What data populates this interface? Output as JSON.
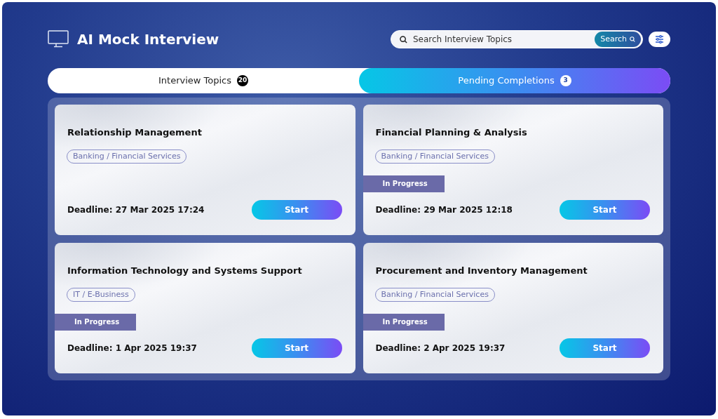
{
  "header": {
    "title": "AI Mock Interview",
    "search": {
      "placeholder": "Search Interview Topics",
      "button": "Search"
    }
  },
  "tabs": [
    {
      "label": "Interview Topics",
      "count": "20",
      "selected": false
    },
    {
      "label": "Pending Completions",
      "count": "3",
      "selected": true
    }
  ],
  "cards": [
    {
      "title": "Relationship Management",
      "tag": "Banking / Financial Services",
      "deadline": "Deadline: 27 Mar 2025 17:24",
      "button": "Start"
    },
    {
      "title": "Financial Planning & Analysis",
      "tag": "Banking / Financial Services",
      "status": "In Progress",
      "deadline": "Deadline: 29 Mar 2025 12:18",
      "button": "Start"
    },
    {
      "title": "Information Technology and Systems Support",
      "tag": "IT / E-Business",
      "status": "In Progress",
      "deadline": "Deadline: 1 Apr 2025 19:37",
      "button": "Start"
    },
    {
      "title": "Procurement and Inventory Management",
      "tag": "Banking / Financial Services",
      "status": "In Progress",
      "deadline": "Deadline: 2 Apr 2025 19:37",
      "button": "Start"
    }
  ]
}
